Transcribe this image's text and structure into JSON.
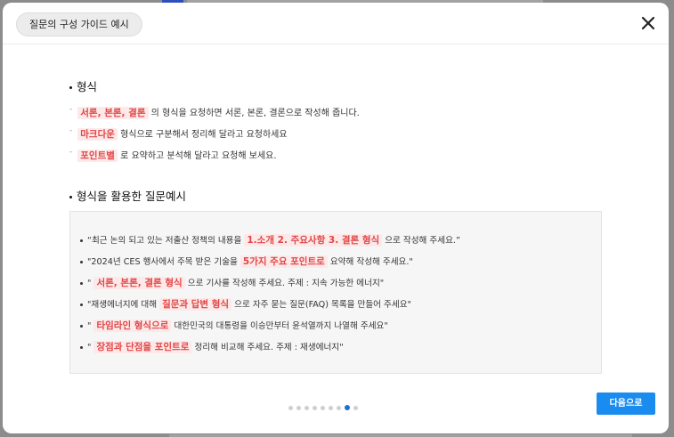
{
  "modal": {
    "title": "질문의 구성 가이드 예시",
    "next_label": "다음으로"
  },
  "format_section": {
    "title": "형식",
    "items": [
      {
        "tag": "서론, 본론, 결론",
        "text": " 의 형식을 요청하면 서론, 본론, 결론으로 작성해 줍니다."
      },
      {
        "tag": "마크다운",
        "text": " 형식으로 구분해서 정리해 달라고 요청하세요"
      },
      {
        "tag": "포인트별",
        "text": " 로 요약하고 분석해 달라고 요청해 보세요."
      }
    ]
  },
  "examples_section": {
    "title": "형식을 활용한 질문예시",
    "items": [
      {
        "before": "“최근 논의 되고 있는 저출산 정책의 내용을 ",
        "tag": "1.소개 2. 주요사항 3. 결론 형식",
        "after": " 으로 작성해 주세요.”"
      },
      {
        "before": "\"2024년 CES 행사에서 주목 받은 기술을 ",
        "tag": "5가지 주요 포인트로",
        "after": " 요약해 작성해 주세요.\""
      },
      {
        "before": "\" ",
        "tag": "서론, 본론, 결론 형식",
        "after": " 으로 기사를 작성해 주세요. 주제 : 지속 가능한 에너지\""
      },
      {
        "before": "\"재생에너지에 대해 ",
        "tag": "질문과 답변 형식",
        "after": " 으로 자주 묻는 질문(FAQ) 목록을 만들어 주세요\""
      },
      {
        "before": "\" ",
        "tag": "타임라인 형식으로",
        "after": " 대한민국의 대통령을 이승만부터 윤석열까지 나열해 주세요\""
      },
      {
        "before": "\" ",
        "tag": "장점과 단점을 포인트로",
        "after": " 정리해 비교해 주세요. 주제 : 재생에너지\""
      }
    ]
  },
  "pagination": {
    "total": 9,
    "current": 8
  },
  "colors": {
    "accent": "#1a8cf0",
    "tag_text": "#e14545",
    "tag_bg": "#fde9e9"
  }
}
